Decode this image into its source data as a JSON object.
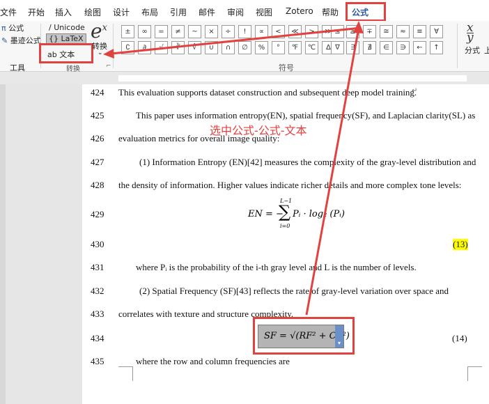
{
  "tabs": [
    "文件",
    "开始",
    "插入",
    "绘图",
    "设计",
    "布局",
    "引用",
    "邮件",
    "审阅",
    "视图",
    "Zotero",
    "帮助",
    "公式"
  ],
  "ribbon": {
    "tools_label": "工具",
    "convert_label": "转换",
    "symbols_label": "符号",
    "formula_btn": "公式",
    "ink_btn": "墨迹公式",
    "unicode_btn": "Unicode",
    "latex_btn": "LaTeX",
    "text_btn": "ab 文本",
    "convert_btn": "转换",
    "fraction_btn": "分式",
    "script_btn": "上",
    "symbols": [
      "±",
      "∞",
      "=",
      "≠",
      "~",
      "×",
      "÷",
      "!",
      "∝",
      "<",
      "≪",
      ">",
      "≫",
      "≤",
      "≥",
      "∓",
      "≅",
      "≈",
      "≡",
      "∀",
      "∁",
      "∂",
      "√",
      "∛",
      "∜",
      "∪",
      "∩",
      "∅",
      "%",
      "°",
      "℉",
      "℃",
      "∆",
      "∇",
      "∃",
      "∄",
      "∈",
      "∋",
      "←",
      "↑"
    ]
  },
  "annotation": "选中公式-公式-文本",
  "lines": [
    {
      "n": "424",
      "text": "This evaluation supports dataset construction and subsequent deep model training."
    },
    {
      "n": "425",
      "text": "This paper uses information entropy(EN), spatial frequency(SF), and Laplacian clarity(SL) as"
    },
    {
      "n": "426",
      "text": "evaluation metrics for overall image quality:"
    },
    {
      "n": "427",
      "text": "(1) Information Entropy (EN)[42] measures the complexity of the gray-level distribution and"
    },
    {
      "n": "428",
      "text": "the density of information. Higher values indicate richer details and more complex tone levels:"
    },
    {
      "n": "429",
      "text": ""
    },
    {
      "n": "430",
      "text": ""
    },
    {
      "n": "431",
      "text": "where  Pᵢ  is the probability of the  i-th gray level and  L  is the number of levels."
    },
    {
      "n": "432",
      "text": "(2) Spatial Frequency (SF)[43] reflects the rate of gray-level variation over space and"
    },
    {
      "n": "433",
      "text": "correlates with texture and structure complexity."
    },
    {
      "n": "434",
      "text": ""
    },
    {
      "n": "435",
      "text": "where the row and column frequencies are"
    }
  ],
  "eq13": {
    "lhs": "EN = −",
    "upper": "L−1",
    "sigma": "∑",
    "lower": "i=0",
    "body": "Pᵢ · log₂ (Pᵢ)",
    "num": "(13)"
  },
  "eq14": {
    "expr": "SF = √(RF² + CF²)",
    "num": "(14)"
  },
  "colors": {
    "accent": "#2b579a",
    "highlight": "#ffff00",
    "annotation_red": "#e2423f"
  }
}
